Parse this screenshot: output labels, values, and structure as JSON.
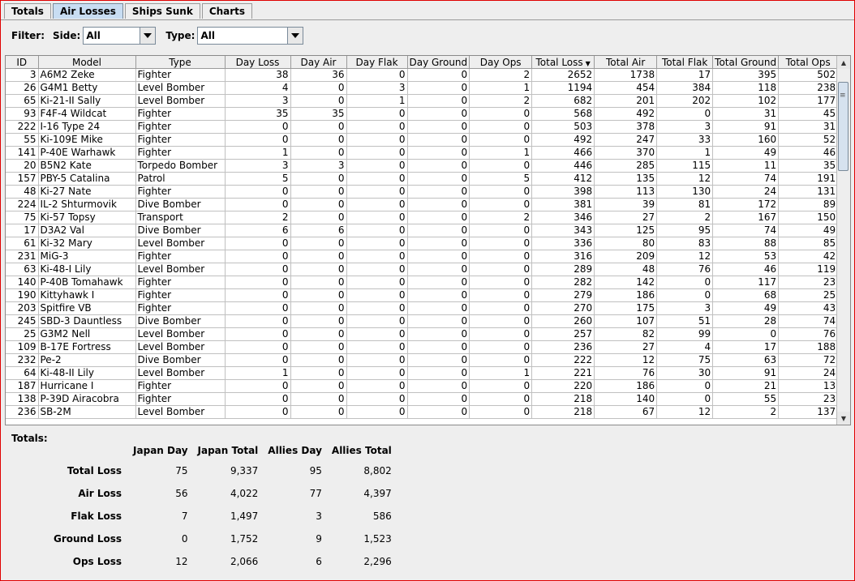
{
  "tabs": [
    {
      "label": "Totals",
      "active": false
    },
    {
      "label": "Air Losses",
      "active": true
    },
    {
      "label": "Ships Sunk",
      "active": false
    },
    {
      "label": "Charts",
      "active": false
    }
  ],
  "filter": {
    "label": "Filter:",
    "side_label": "Side:",
    "side_value": "All",
    "type_label": "Type:",
    "type_value": "All"
  },
  "table": {
    "columns": [
      "ID",
      "Model",
      "Type",
      "Day Loss",
      "Day Air",
      "Day Flak",
      "Day Ground",
      "Day Ops",
      "Total Loss",
      "Total Air",
      "Total Flak",
      "Total Ground",
      "Total Ops"
    ],
    "sorted_column": "Total Loss",
    "rows": [
      [
        "3",
        "A6M2 Zeke",
        "Fighter",
        "38",
        "36",
        "0",
        "0",
        "2",
        "2652",
        "1738",
        "17",
        "395",
        "502"
      ],
      [
        "26",
        "G4M1 Betty",
        "Level Bomber",
        "4",
        "0",
        "3",
        "0",
        "1",
        "1194",
        "454",
        "384",
        "118",
        "238"
      ],
      [
        "65",
        "Ki-21-II Sally",
        "Level Bomber",
        "3",
        "0",
        "1",
        "0",
        "2",
        "682",
        "201",
        "202",
        "102",
        "177"
      ],
      [
        "93",
        "F4F-4 Wildcat",
        "Fighter",
        "35",
        "35",
        "0",
        "0",
        "0",
        "568",
        "492",
        "0",
        "31",
        "45"
      ],
      [
        "222",
        "I-16 Type 24",
        "Fighter",
        "0",
        "0",
        "0",
        "0",
        "0",
        "503",
        "378",
        "3",
        "91",
        "31"
      ],
      [
        "55",
        "Ki-109E Mike",
        "Fighter",
        "0",
        "0",
        "0",
        "0",
        "0",
        "492",
        "247",
        "33",
        "160",
        "52"
      ],
      [
        "141",
        "P-40E Warhawk",
        "Fighter",
        "1",
        "0",
        "0",
        "0",
        "1",
        "466",
        "370",
        "1",
        "49",
        "46"
      ],
      [
        "20",
        "B5N2 Kate",
        "Torpedo Bomber",
        "3",
        "3",
        "0",
        "0",
        "0",
        "446",
        "285",
        "115",
        "11",
        "35"
      ],
      [
        "157",
        "PBY-5 Catalina",
        "Patrol",
        "5",
        "0",
        "0",
        "0",
        "5",
        "412",
        "135",
        "12",
        "74",
        "191"
      ],
      [
        "48",
        "Ki-27 Nate",
        "Fighter",
        "0",
        "0",
        "0",
        "0",
        "0",
        "398",
        "113",
        "130",
        "24",
        "131"
      ],
      [
        "224",
        "IL-2 Shturmovik",
        "Dive Bomber",
        "0",
        "0",
        "0",
        "0",
        "0",
        "381",
        "39",
        "81",
        "172",
        "89"
      ],
      [
        "75",
        "Ki-57 Topsy",
        "Transport",
        "2",
        "0",
        "0",
        "0",
        "2",
        "346",
        "27",
        "2",
        "167",
        "150"
      ],
      [
        "17",
        "D3A2 Val",
        "Dive Bomber",
        "6",
        "6",
        "0",
        "0",
        "0",
        "343",
        "125",
        "95",
        "74",
        "49"
      ],
      [
        "61",
        "Ki-32 Mary",
        "Level Bomber",
        "0",
        "0",
        "0",
        "0",
        "0",
        "336",
        "80",
        "83",
        "88",
        "85"
      ],
      [
        "231",
        "MiG-3",
        "Fighter",
        "0",
        "0",
        "0",
        "0",
        "0",
        "316",
        "209",
        "12",
        "53",
        "42"
      ],
      [
        "63",
        "Ki-48-I Lily",
        "Level Bomber",
        "0",
        "0",
        "0",
        "0",
        "0",
        "289",
        "48",
        "76",
        "46",
        "119"
      ],
      [
        "140",
        "P-40B Tomahawk",
        "Fighter",
        "0",
        "0",
        "0",
        "0",
        "0",
        "282",
        "142",
        "0",
        "117",
        "23"
      ],
      [
        "190",
        "Kittyhawk I",
        "Fighter",
        "0",
        "0",
        "0",
        "0",
        "0",
        "279",
        "186",
        "0",
        "68",
        "25"
      ],
      [
        "203",
        "Spitfire VB",
        "Fighter",
        "0",
        "0",
        "0",
        "0",
        "0",
        "270",
        "175",
        "3",
        "49",
        "43"
      ],
      [
        "245",
        "SBD-3 Dauntless",
        "Dive Bomber",
        "0",
        "0",
        "0",
        "0",
        "0",
        "260",
        "107",
        "51",
        "28",
        "74"
      ],
      [
        "25",
        "G3M2 Nell",
        "Level Bomber",
        "0",
        "0",
        "0",
        "0",
        "0",
        "257",
        "82",
        "99",
        "0",
        "76"
      ],
      [
        "109",
        "B-17E Fortress",
        "Level Bomber",
        "0",
        "0",
        "0",
        "0",
        "0",
        "236",
        "27",
        "4",
        "17",
        "188"
      ],
      [
        "232",
        "Pe-2",
        "Dive Bomber",
        "0",
        "0",
        "0",
        "0",
        "0",
        "222",
        "12",
        "75",
        "63",
        "72"
      ],
      [
        "64",
        "Ki-48-II Lily",
        "Level Bomber",
        "1",
        "0",
        "0",
        "0",
        "1",
        "221",
        "76",
        "30",
        "91",
        "24"
      ],
      [
        "187",
        "Hurricane I",
        "Fighter",
        "0",
        "0",
        "0",
        "0",
        "0",
        "220",
        "186",
        "0",
        "21",
        "13"
      ],
      [
        "138",
        "P-39D Airacobra",
        "Fighter",
        "0",
        "0",
        "0",
        "0",
        "0",
        "218",
        "140",
        "0",
        "55",
        "23"
      ],
      [
        "236",
        "SB-2M",
        "Level Bomber",
        "0",
        "0",
        "0",
        "0",
        "0",
        "218",
        "67",
        "12",
        "2",
        "137"
      ]
    ]
  },
  "totals": {
    "title": "Totals:",
    "headers": [
      "Japan Day",
      "Japan Total",
      "Allies Day",
      "Allies Total"
    ],
    "rows": [
      {
        "label": "Total Loss",
        "values": [
          "75",
          "9,337",
          "95",
          "8,802"
        ]
      },
      {
        "label": "Air Loss",
        "values": [
          "56",
          "4,022",
          "77",
          "4,397"
        ]
      },
      {
        "label": "Flak Loss",
        "values": [
          "7",
          "1,497",
          "3",
          "586"
        ]
      },
      {
        "label": "Ground Loss",
        "values": [
          "0",
          "1,752",
          "9",
          "1,523"
        ]
      },
      {
        "label": "Ops Loss",
        "values": [
          "12",
          "2,066",
          "6",
          "2,296"
        ]
      }
    ]
  },
  "colors": {
    "frame": "#e00000",
    "active_tab": "#c8ddf2",
    "background": "#eeeeee"
  }
}
